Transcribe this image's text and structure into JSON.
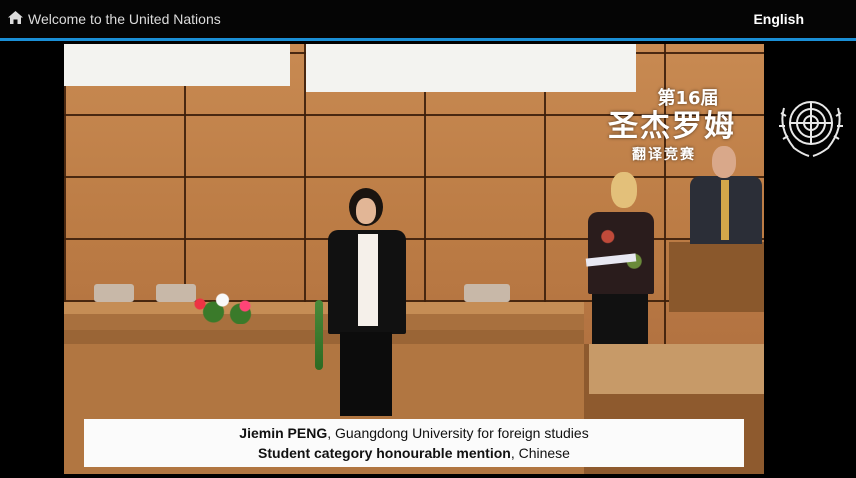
{
  "header": {
    "home_label": "Welcome to the United Nations",
    "home_icon": "home-icon",
    "language": "English"
  },
  "event_logo": {
    "line1": "第16届",
    "line2": "圣杰罗姆",
    "line3": "翻译竞赛"
  },
  "caption": {
    "name": "Jiemin PENG",
    "affiliation": ", Guangdong University for foreign studies",
    "award": "Student category honourable mention",
    "language": ", Chinese"
  },
  "colors": {
    "accent": "#1a8fd6",
    "header_bg": "#050505",
    "caption_bg": "#fbfbfb"
  }
}
